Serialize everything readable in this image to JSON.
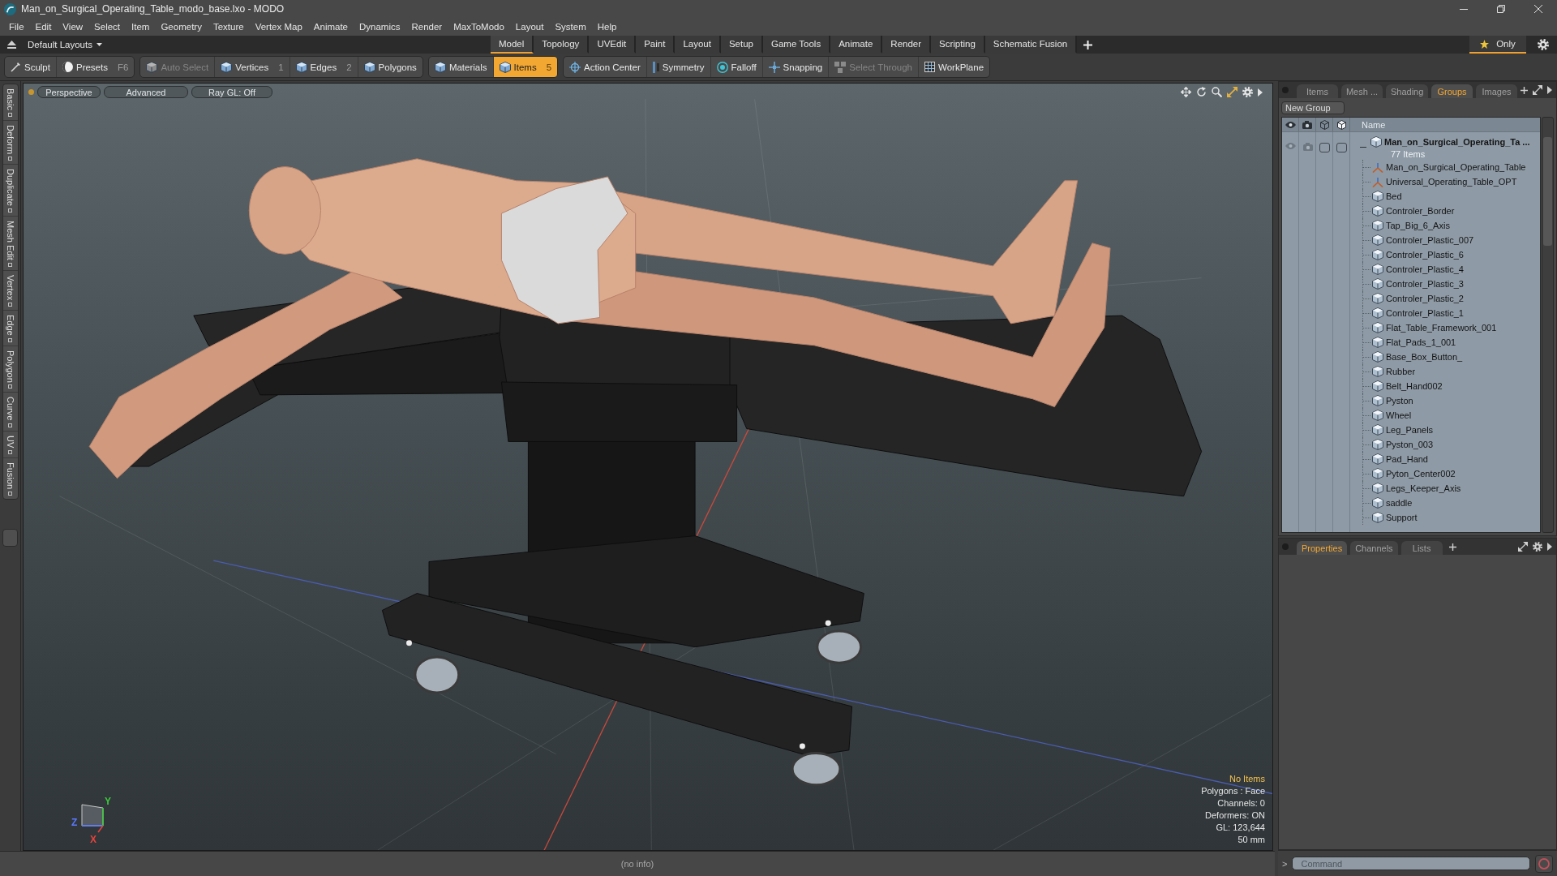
{
  "window": {
    "title": "Man_on_Surgical_Operating_Table_modo_base.lxo - MODO"
  },
  "menu": [
    "File",
    "Edit",
    "View",
    "Select",
    "Item",
    "Geometry",
    "Texture",
    "Vertex Map",
    "Animate",
    "Dynamics",
    "Render",
    "MaxToModo",
    "Layout",
    "System",
    "Help"
  ],
  "layout_bar": {
    "layouts_menu": "Default Layouts",
    "tabs": [
      {
        "label": "Model",
        "selected": true
      },
      {
        "label": "Topology",
        "selected": false
      },
      {
        "label": "UVEdit",
        "selected": false
      },
      {
        "label": "Paint",
        "selected": false
      },
      {
        "label": "Layout",
        "selected": false
      },
      {
        "label": "Setup",
        "selected": false
      },
      {
        "label": "Game Tools",
        "selected": false
      },
      {
        "label": "Animate",
        "selected": false
      },
      {
        "label": "Render",
        "selected": false
      },
      {
        "label": "Scripting",
        "selected": false
      },
      {
        "label": "Schematic Fusion",
        "selected": false
      }
    ],
    "only": {
      "label": "Only",
      "on": true
    }
  },
  "toolbar": {
    "groups": [
      {
        "buttons": [
          {
            "label": "Sculpt",
            "selected": false,
            "disabled": false
          },
          {
            "label": "Presets",
            "shortcut": "F6",
            "selected": false,
            "disabled": false
          }
        ]
      },
      {
        "buttons": [
          {
            "label": "Auto Select",
            "selected": false,
            "disabled": true
          },
          {
            "label": "Vertices",
            "shortcut": "1",
            "selected": false,
            "disabled": false
          },
          {
            "label": "Edges",
            "shortcut": "2",
            "selected": false,
            "disabled": false
          },
          {
            "label": "Polygons",
            "selected": false,
            "disabled": false
          }
        ]
      },
      {
        "buttons": [
          {
            "label": "Materials",
            "selected": false,
            "disabled": false
          },
          {
            "label": "Items",
            "shortcut": "5",
            "selected": true,
            "disabled": false
          }
        ]
      },
      {
        "buttons": [
          {
            "label": "Action Center",
            "selected": false,
            "disabled": false
          },
          {
            "label": "Symmetry",
            "selected": false,
            "disabled": false
          },
          {
            "label": "Falloff",
            "selected": false,
            "disabled": false
          },
          {
            "label": "Snapping",
            "selected": false,
            "disabled": false
          },
          {
            "label": "Select Through",
            "selected": false,
            "disabled": true
          },
          {
            "label": "WorkPlane",
            "selected": false,
            "disabled": false
          }
        ]
      }
    ]
  },
  "side_tabs": [
    "Basic",
    "Deform",
    "Duplicate",
    "Mesh Edit",
    "Vertex",
    "Edge",
    "Polygon",
    "Curve",
    "UV",
    "Fusion"
  ],
  "viewport": {
    "header": [
      "Perspective",
      "Advanced",
      "Ray GL: Off"
    ],
    "info": [
      {
        "text": "No Items",
        "highlighted": true
      },
      {
        "text": "Polygons : Face",
        "highlighted": false
      },
      {
        "text": "Channels: 0",
        "highlighted": false
      },
      {
        "text": "Deformers: ON",
        "highlighted": false
      },
      {
        "text": "GL: 123,644",
        "highlighted": false
      },
      {
        "text": "50 mm",
        "highlighted": false
      }
    ],
    "gizmo_labels": [
      {
        "label": "Y",
        "color": "#3cc83c"
      },
      {
        "label": "Z",
        "color": "#5a78ff"
      },
      {
        "label": "X",
        "color": "#e8423c"
      }
    ]
  },
  "status_bar": {
    "text": "(no info)"
  },
  "groups_panel": {
    "tabs": [
      {
        "label": "Items",
        "selected": false
      },
      {
        "label": "Mesh ...",
        "selected": false
      },
      {
        "label": "Shading",
        "selected": false
      },
      {
        "label": "Groups",
        "selected": true
      },
      {
        "label": "Images",
        "selected": false
      }
    ],
    "new_group": "New Group",
    "name_column": "Name",
    "tree": [
      {
        "name": "Man_on_Surgical_Operating_Ta ...",
        "count": "77 Items",
        "kind": "group",
        "expanded": true,
        "children": [
          {
            "name": "Man_on_Surgical_Operating_Table",
            "kind": "locator"
          },
          {
            "name": "Universal_Operating_Table_OPT",
            "kind": "locator"
          },
          {
            "name": "Bed",
            "kind": "mesh"
          },
          {
            "name": "Controler_Border",
            "kind": "mesh"
          },
          {
            "name": "Tap_Big_6_Axis",
            "kind": "mesh"
          },
          {
            "name": "Controler_Plastic_007",
            "kind": "mesh"
          },
          {
            "name": "Controler_Plastic_6",
            "kind": "mesh"
          },
          {
            "name": "Controler_Plastic_4",
            "kind": "mesh"
          },
          {
            "name": "Controler_Plastic_3",
            "kind": "mesh"
          },
          {
            "name": "Controler_Plastic_2",
            "kind": "mesh"
          },
          {
            "name": "Controler_Plastic_1",
            "kind": "mesh"
          },
          {
            "name": "Flat_Table_Framework_001",
            "kind": "mesh"
          },
          {
            "name": "Flat_Pads_1_001",
            "kind": "mesh"
          },
          {
            "name": "Base_Box_Button_",
            "kind": "mesh"
          },
          {
            "name": "Rubber",
            "kind": "mesh"
          },
          {
            "name": "Belt_Hand002",
            "kind": "mesh"
          },
          {
            "name": "Pyston",
            "kind": "mesh"
          },
          {
            "name": "Wheel",
            "kind": "mesh"
          },
          {
            "name": "Leg_Panels",
            "kind": "mesh"
          },
          {
            "name": "Pyston_003",
            "kind": "mesh"
          },
          {
            "name": "Pad_Hand",
            "kind": "mesh"
          },
          {
            "name": "Pyton_Center002",
            "kind": "mesh"
          },
          {
            "name": "Legs_Keeper_Axis",
            "kind": "mesh"
          },
          {
            "name": "saddle",
            "kind": "mesh"
          },
          {
            "name": "Support",
            "kind": "mesh"
          }
        ]
      }
    ]
  },
  "properties_panel": {
    "tabs": [
      {
        "label": "Properties",
        "selected": true
      },
      {
        "label": "Channels",
        "selected": false
      },
      {
        "label": "Lists",
        "selected": false
      }
    ]
  },
  "command": {
    "prompt": ">",
    "placeholder": "Command"
  }
}
